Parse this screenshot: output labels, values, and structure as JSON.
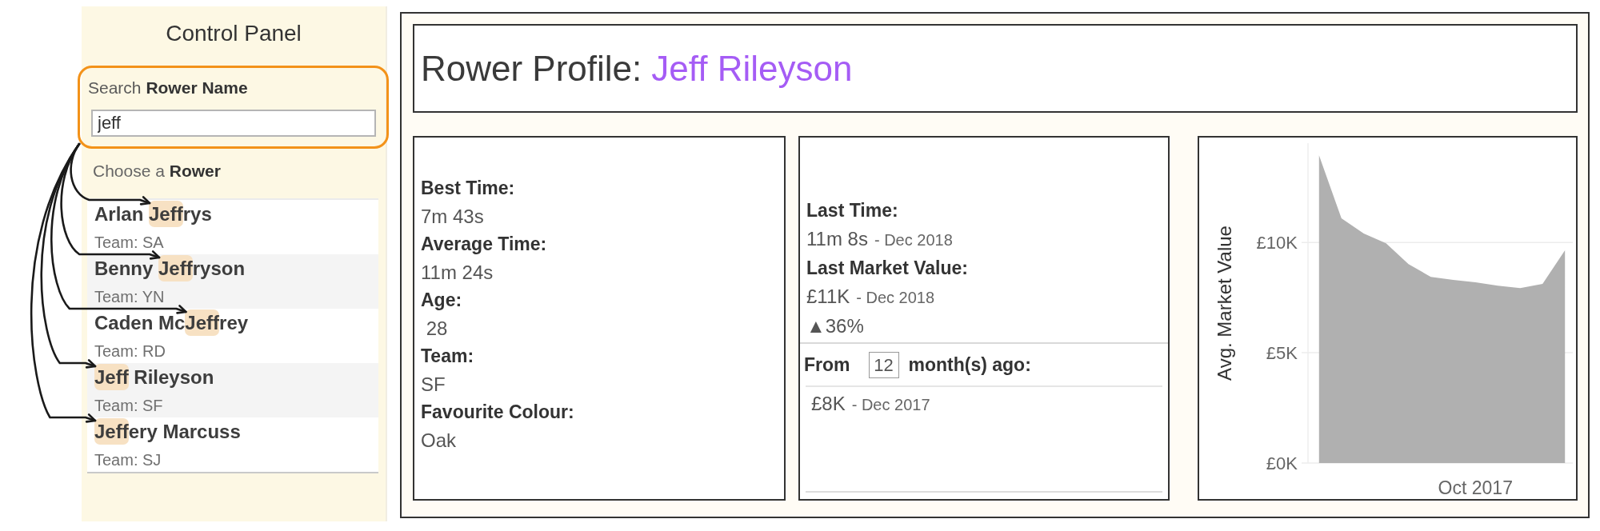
{
  "control_panel": {
    "title": "Control Panel",
    "search": {
      "label": "Search **Rower Name**",
      "value": "jeff"
    },
    "chooser": {
      "label": "Choose a **Rower**",
      "rowers": [
        {
          "name": [
            {
              "text": "Arlan ",
              "highlighted": false
            },
            {
              "text": "Jeff",
              "highlighted": true
            },
            {
              "text": "rys",
              "highlighted": false
            }
          ],
          "team": "Team: SA"
        },
        {
          "name": [
            {
              "text": "Benny ",
              "highlighted": false
            },
            {
              "text": "Jeff",
              "highlighted": true
            },
            {
              "text": "ryson",
              "highlighted": false
            }
          ],
          "team": "Team: YN"
        },
        {
          "name": [
            {
              "text": "Caden Mc",
              "highlighted": false
            },
            {
              "text": "Jeff",
              "highlighted": true
            },
            {
              "text": "rey",
              "highlighted": false
            }
          ],
          "team": "Team: RD"
        },
        {
          "name": [
            {
              "text": "Jeff",
              "highlighted": true
            },
            {
              "text": " Rileyson",
              "highlighted": false
            }
          ],
          "team": "Team: SF"
        },
        {
          "name": [
            {
              "text": "Jeff",
              "highlighted": true
            },
            {
              "text": "ery Marcuss",
              "highlighted": false
            }
          ],
          "team": "Team: SJ"
        }
      ]
    }
  },
  "profile": {
    "title": "Rower Profile:",
    "rower_name": "Jeff Rileyson",
    "stats": [
      {
        "label": "Best Time:",
        "value": "7m 43s"
      },
      {
        "label": "Average Time:",
        "value": "11m 24s"
      },
      {
        "label": "Age:",
        "value": " 28"
      },
      {
        "label": "Team:",
        "value": "SF"
      },
      {
        "label": "Favourite Colour:",
        "value": "Oak"
      }
    ],
    "market": {
      "last_time": {
        "label": "Last Time:",
        "value": "11m 8s",
        "date": "- Dec 2018"
      },
      "last_value": {
        "label": "Last Market Value:",
        "value": "£11K",
        "date": "- Dec 2018"
      },
      "change": "▲36%",
      "comparison": {
        "from_label": "From",
        "months": "12",
        "months_label": "month(s) ago:",
        "value": "£8K",
        "date": "- Dec 2017"
      }
    },
    "market_chart": {
      "chart_data": {
        "type": "area",
        "ylabel": "Avg. Market Value",
        "series": [
          {
            "color": "#b0b0b0",
            "values": [
              13950,
              11090,
              10400,
              9960,
              9020,
              8440,
              8300,
              8190,
              8040,
              7930,
              8120,
              9640
            ]
          }
        ],
        "ylim": [
          0,
          14500
        ],
        "yticks": [
          {
            "value": 0,
            "label": "£0K"
          },
          {
            "value": 5000,
            "label": "£5K"
          },
          {
            "value": 10000,
            "label": "£10K"
          }
        ],
        "annotations": [
          {
            "text": "Oct 2017"
          }
        ]
      }
    }
  }
}
